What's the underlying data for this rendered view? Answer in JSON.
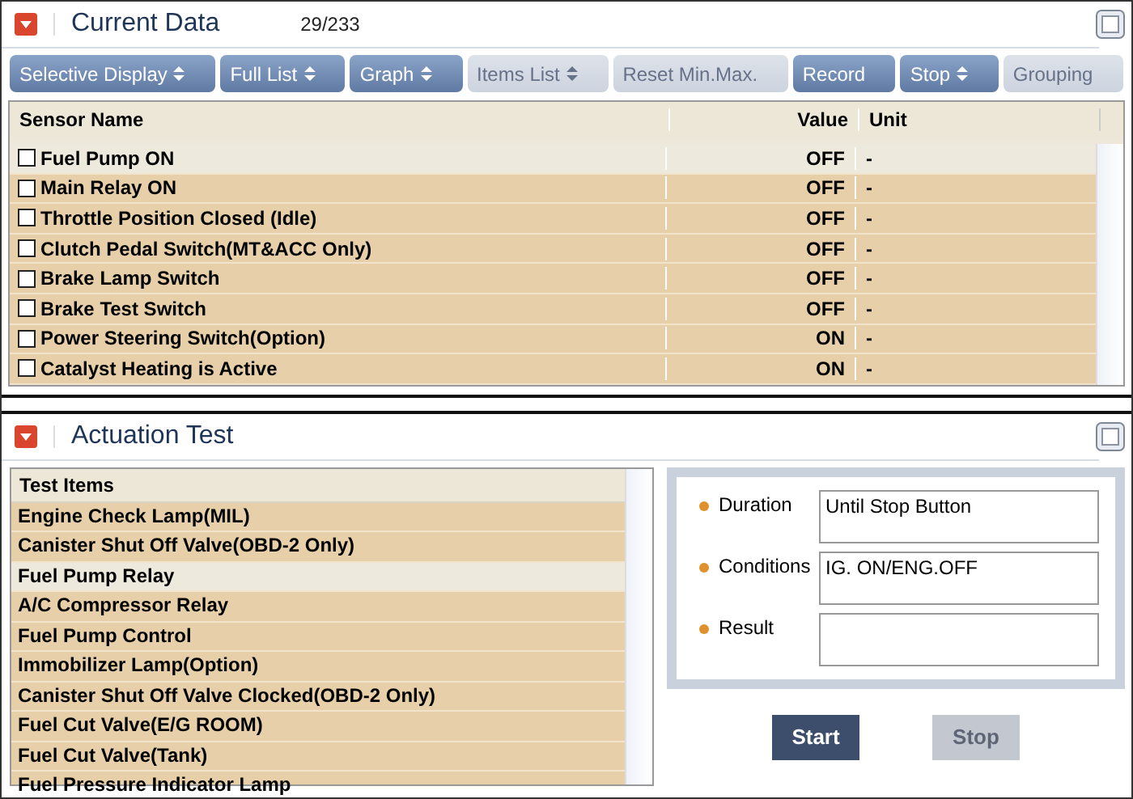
{
  "current_data": {
    "title": "Current Data",
    "count": "29/233",
    "toolbar": [
      {
        "label": "Selective Display",
        "disabled": false,
        "kind": "dropdown"
      },
      {
        "label": "Full List",
        "disabled": false,
        "kind": "dropdown"
      },
      {
        "label": "Graph",
        "disabled": false,
        "kind": "dropdown"
      },
      {
        "label": "Items List",
        "disabled": true,
        "kind": "dropdown"
      },
      {
        "label": "Reset Min.Max.",
        "disabled": true,
        "kind": "plain"
      },
      {
        "label": "Record",
        "disabled": false,
        "kind": "plain"
      },
      {
        "label": "Stop",
        "disabled": false,
        "kind": "dropdown"
      },
      {
        "label": "Grouping",
        "disabled": true,
        "kind": "plain"
      }
    ],
    "columns": [
      "Sensor Name",
      "Value",
      "Unit"
    ],
    "rows": [
      {
        "name": "Fuel Pump ON",
        "value": "OFF",
        "unit": "-",
        "checked": false,
        "selected": true
      },
      {
        "name": "Main Relay ON",
        "value": "OFF",
        "unit": "-",
        "checked": false,
        "selected": false
      },
      {
        "name": "Throttle Position Closed (Idle)",
        "value": "OFF",
        "unit": "-",
        "checked": false,
        "selected": false
      },
      {
        "name": "Clutch Pedal Switch(MT&ACC Only)",
        "value": "OFF",
        "unit": "-",
        "checked": false,
        "selected": false
      },
      {
        "name": "Brake Lamp Switch",
        "value": "OFF",
        "unit": "-",
        "checked": false,
        "selected": false
      },
      {
        "name": "Brake Test Switch",
        "value": "OFF",
        "unit": "-",
        "checked": false,
        "selected": false
      },
      {
        "name": "Power Steering Switch(Option)",
        "value": "ON",
        "unit": "-",
        "checked": false,
        "selected": false
      },
      {
        "name": "Catalyst Heating is Active",
        "value": "ON",
        "unit": "-",
        "checked": false,
        "selected": false
      }
    ]
  },
  "actuation_test": {
    "title": "Actuation Test",
    "list_header": "Test Items",
    "items": [
      {
        "label": "Engine Check Lamp(MIL)",
        "selected": false
      },
      {
        "label": "Canister Shut Off Valve(OBD-2 Only)",
        "selected": false
      },
      {
        "label": "Fuel Pump Relay",
        "selected": true
      },
      {
        "label": "A/C Compressor Relay",
        "selected": false
      },
      {
        "label": "Fuel Pump Control",
        "selected": false
      },
      {
        "label": "Immobilizer Lamp(Option)",
        "selected": false
      },
      {
        "label": "Canister Shut Off Valve Clocked(OBD-2 Only)",
        "selected": false
      },
      {
        "label": "Fuel Cut Valve(E/G ROOM)",
        "selected": false
      },
      {
        "label": "Fuel Cut Valve(Tank)",
        "selected": false
      },
      {
        "label": "Fuel Pressure Indicator Lamp",
        "selected": false
      }
    ],
    "fields": [
      {
        "label": "Duration",
        "value": "Until Stop Button"
      },
      {
        "label": "Conditions",
        "value": "IG. ON/ENG.OFF"
      },
      {
        "label": "Result"
      }
    ],
    "buttons": [
      {
        "label": "Start",
        "disabled": false
      },
      {
        "label": "Stop",
        "disabled": true
      }
    ]
  }
}
